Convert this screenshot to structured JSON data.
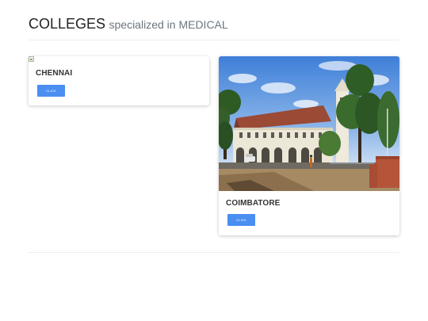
{
  "header": {
    "title": "COLLEGES",
    "subtitle": "specialized in MEDICAL"
  },
  "cards": [
    {
      "city": "CHENNAI",
      "button_label": "CLICK",
      "image": "broken-image-icon"
    },
    {
      "city": "COIMBATORE",
      "button_label": "CLICK",
      "image": "college-building-photo"
    }
  ],
  "colors": {
    "button": "#4a8ef2",
    "title": "#222222",
    "subtitle": "#6c757d"
  }
}
